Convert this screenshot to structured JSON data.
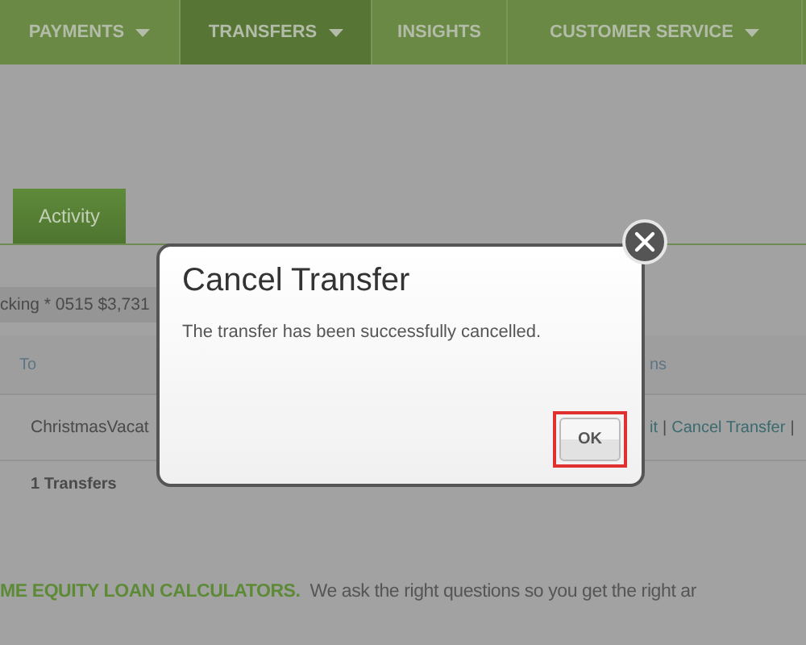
{
  "nav": [
    {
      "label": "PAYMENTS",
      "dropdown": true,
      "selected": false
    },
    {
      "label": "TRANSFERS",
      "dropdown": true,
      "selected": true
    },
    {
      "label": "INSIGHTS",
      "dropdown": false,
      "selected": false
    },
    {
      "label": "CUSTOMER SERVICE",
      "dropdown": true,
      "selected": false
    }
  ],
  "tabs": [
    {
      "label": "Activity",
      "selected": true
    }
  ],
  "account": "cking * 0515 $3,731",
  "table": {
    "columns": [
      "To",
      "ns"
    ],
    "rows": [
      {
        "to": "ChristmasVacat",
        "actions": {
          "links": [
            "it",
            "Cancel Transfer"
          ],
          "separator": "|"
        }
      }
    ],
    "count": "1 Transfers"
  },
  "promo": {
    "heading": "ME EQUITY LOAN CALCULATORS.",
    "text": "We ask the right questions so you get the right ar"
  },
  "dialog": {
    "title": "Cancel Transfer",
    "message": "The transfer has been successfully cancelled.",
    "button": {
      "label": "OK",
      "highlighted": true
    }
  }
}
